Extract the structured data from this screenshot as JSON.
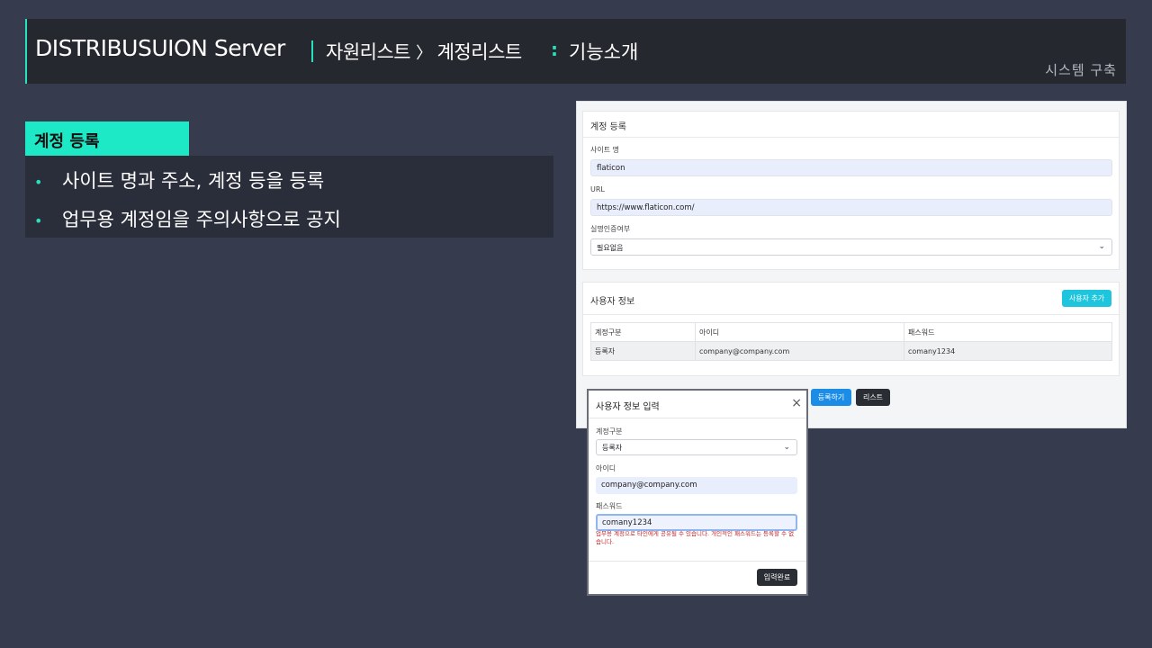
{
  "header": {
    "title": "DISTRIBUSUION Server",
    "breadcrumb_1": "자원리스트",
    "breadcrumb_sep": "〉",
    "breadcrumb_2": "계정리스트",
    "section": "기능소개",
    "right_label": "시스템  구축"
  },
  "left": {
    "label": "계정 등록",
    "bullets": [
      "사이트 명과 주소, 계정 등을 등록",
      "업무용 계정임을 주의사항으로 공지"
    ]
  },
  "form": {
    "card_title": "계정 등록",
    "site_label": "사이트 명",
    "site_value": "flaticon",
    "url_label": "URL",
    "url_value": "https://www.flaticon.com/",
    "auth_label": "실명인증여부",
    "auth_value": "필요없음",
    "user_card_title": "사용자 정보",
    "add_user_label": "사용자 추가",
    "table": {
      "headers": [
        "계정구분",
        "아이디",
        "패스워드"
      ],
      "rows": [
        [
          "등록자",
          "company@company.com",
          "comany1234"
        ]
      ]
    },
    "register_label": "등록하기",
    "list_label": "리스트"
  },
  "modal": {
    "title": "사용자 정보 입력",
    "type_label": "계정구분",
    "type_value": "등록자",
    "id_label": "아이디",
    "id_value": "company@company.com",
    "pw_label": "패스워드",
    "pw_value": "comany1234",
    "warning": "업무용 계정으로 타인에게 공유될 수 있습니다. 개인적인 패스워드는 등록할 수 없습니다.",
    "done_label": "입력완료"
  },
  "colors": {
    "accent": "#1de9c6",
    "background": "#363b4e",
    "primary_button": "#1c8de6",
    "add_button": "#1fc5dc",
    "warning": "#c0242a"
  }
}
